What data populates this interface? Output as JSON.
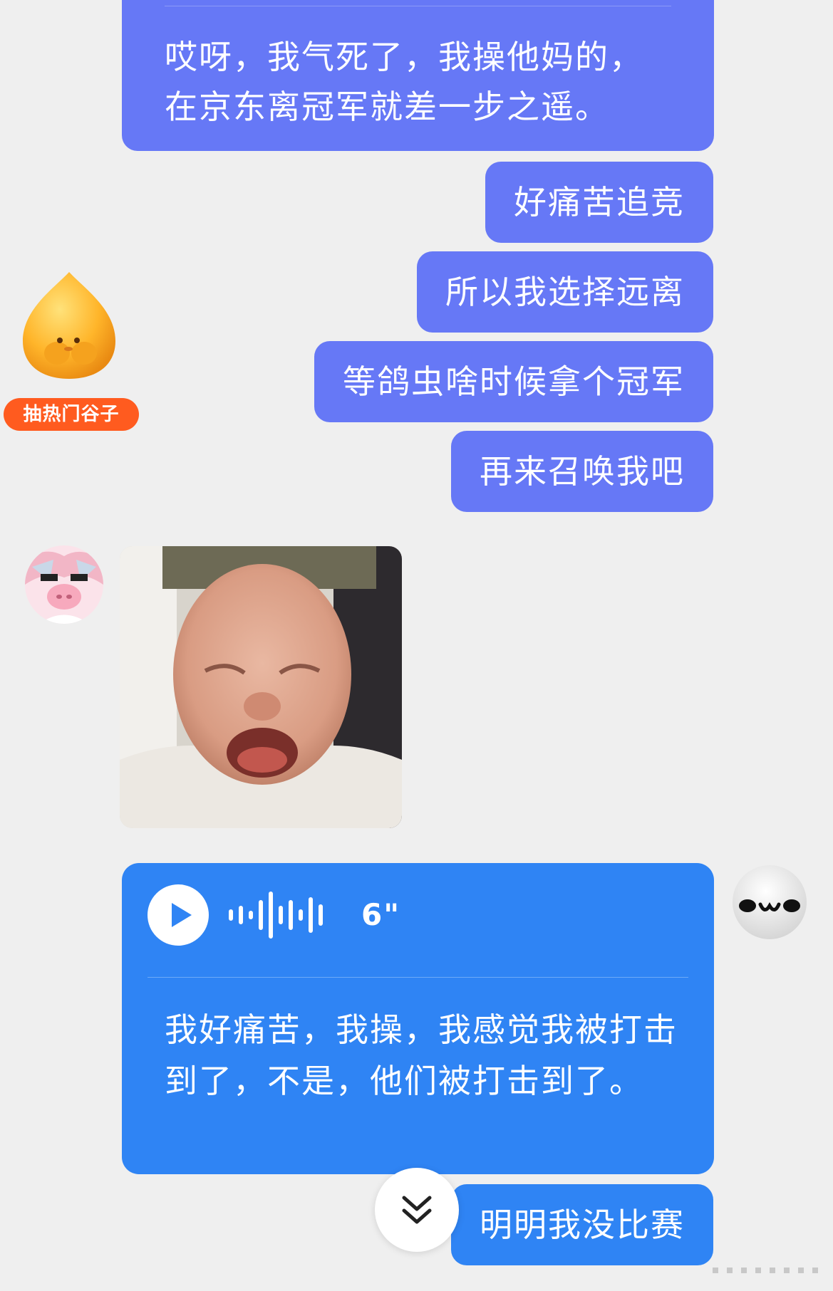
{
  "messages": [
    {
      "id": "msg1",
      "text": "哎呀，我气死了，我操他妈的，在京东离冠军就差一步之遥。"
    },
    {
      "id": "msg2",
      "text": "好痛苦追竞"
    },
    {
      "id": "msg3",
      "text": "所以我选择远离"
    },
    {
      "id": "msg4",
      "text": "等鸽虫啥时候拿个冠军"
    },
    {
      "id": "msg5",
      "text": "再来召唤我吧"
    },
    {
      "id": "msg7",
      "text": "明明我没比赛"
    }
  ],
  "peach_avatar_badge": "抽热门谷子",
  "voice_message": {
    "duration": "6\"",
    "transcript": "我好痛苦，我操，我感觉我被打击到了，不是，他们被打击到了。"
  },
  "icons": {
    "play": "play-icon",
    "scroll_down": "double-chevron-down-icon"
  },
  "colors": {
    "purple_bubble": "#6678f6",
    "blue_bubble": "#2f84f4",
    "badge": "#ff5b1f",
    "background": "#efefef"
  }
}
